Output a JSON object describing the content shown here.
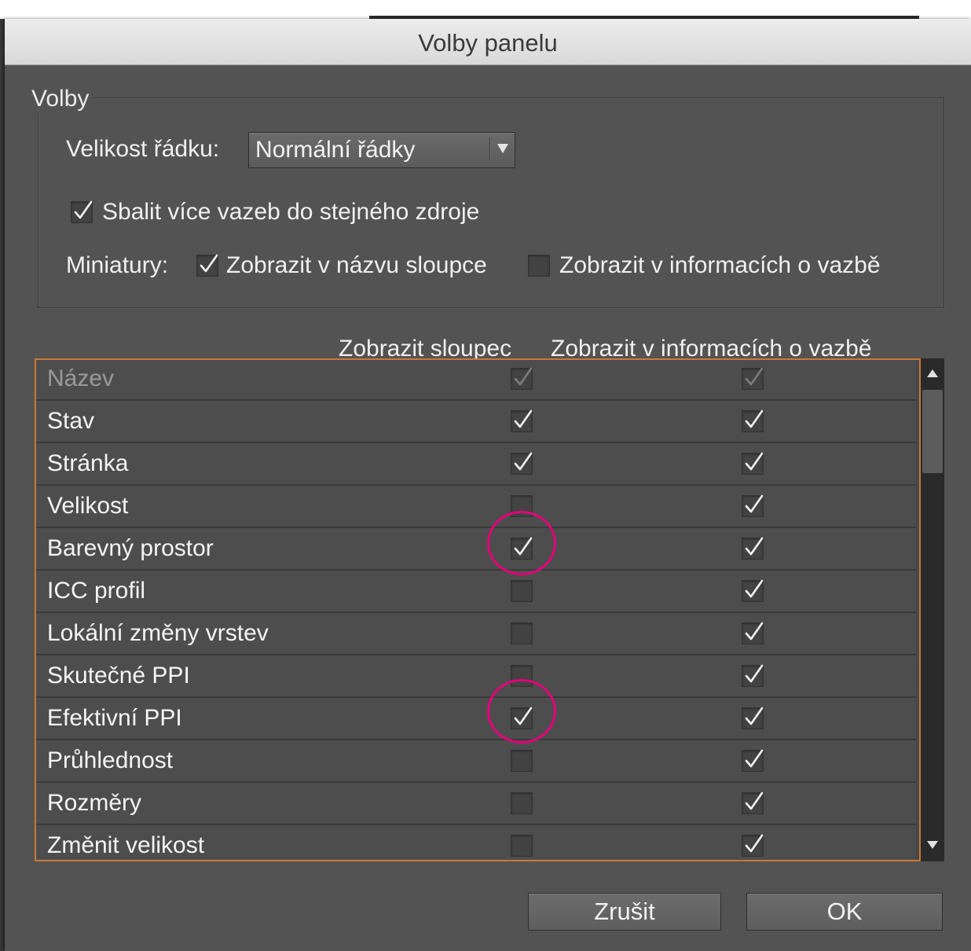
{
  "dialog": {
    "title": "Volby panelu"
  },
  "options_group": {
    "legend": "Volby",
    "row_size_label": "Velikost řádku:",
    "row_size_value": "Normální řádky",
    "collapse_links_label": "Sbalit více vazeb do stejného zdroje",
    "collapse_links_checked": true,
    "thumbnails_label": "Miniatury:",
    "thumb_in_column_label": "Zobrazit v názvu sloupce",
    "thumb_in_column_checked": true,
    "thumb_in_info_label": "Zobrazit v informacích o vazbě",
    "thumb_in_info_checked": false
  },
  "columns": {
    "show_column_header": "Zobrazit sloupec",
    "show_in_info_header": "Zobrazit v informacích o vazbě"
  },
  "rows": [
    {
      "label": "Název",
      "show_column": true,
      "show_info": true,
      "disabled": true
    },
    {
      "label": "Stav",
      "show_column": true,
      "show_info": true,
      "disabled": false
    },
    {
      "label": "Stránka",
      "show_column": true,
      "show_info": true,
      "disabled": false
    },
    {
      "label": "Velikost",
      "show_column": false,
      "show_info": true,
      "disabled": false
    },
    {
      "label": "Barevný prostor",
      "show_column": true,
      "show_info": true,
      "disabled": false,
      "highlighted": true
    },
    {
      "label": "ICC profil",
      "show_column": false,
      "show_info": true,
      "disabled": false
    },
    {
      "label": "Lokální změny vrstev",
      "show_column": false,
      "show_info": true,
      "disabled": false
    },
    {
      "label": "Skutečné PPI",
      "show_column": false,
      "show_info": true,
      "disabled": false
    },
    {
      "label": "Efektivní PPI",
      "show_column": true,
      "show_info": true,
      "disabled": false,
      "highlighted": true
    },
    {
      "label": "Průhlednost",
      "show_column": false,
      "show_info": true,
      "disabled": false
    },
    {
      "label": "Rozměry",
      "show_column": false,
      "show_info": true,
      "disabled": false
    },
    {
      "label": "Změnit velikost",
      "show_column": false,
      "show_info": true,
      "disabled": false
    }
  ],
  "buttons": {
    "cancel_label": "Zrušit",
    "ok_label": "OK"
  },
  "colors": {
    "dialog_bg": "#535353",
    "list_border_accent": "#c87a36",
    "annotation_circle": "#e4007a"
  }
}
